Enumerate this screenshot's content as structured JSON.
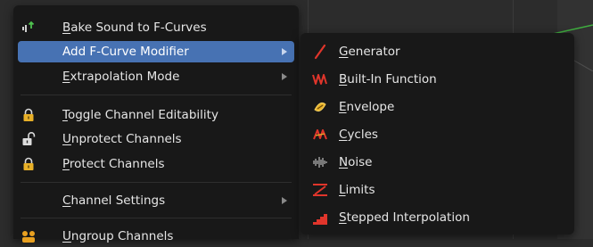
{
  "main_menu": {
    "items": [
      {
        "label": "Bake Sound to F-Curves",
        "icon": "speaker-bake-icon"
      },
      {
        "label": "Add F-Curve Modifier",
        "icon": null,
        "submenu": true,
        "active": true
      },
      {
        "label": "Extrapolation Mode",
        "icon": null,
        "submenu": true
      },
      {
        "label": "Toggle Channel Editability",
        "icon": "lock-icon"
      },
      {
        "label": "Unprotect Channels",
        "icon": "unlocked-icon"
      },
      {
        "label": "Protect Channels",
        "icon": "lock-icon"
      },
      {
        "label": "Channel Settings",
        "icon": null,
        "submenu": true
      },
      {
        "label": "Ungroup Channels",
        "icon": "group-icon"
      }
    ]
  },
  "sub_menu": {
    "items": [
      {
        "label": "Generator",
        "icon": "generator-icon"
      },
      {
        "label": "Built-In Function",
        "icon": "built-in-function-icon"
      },
      {
        "label": "Envelope",
        "icon": "envelope-icon"
      },
      {
        "label": "Cycles",
        "icon": "cycles-icon"
      },
      {
        "label": "Noise",
        "icon": "noise-icon"
      },
      {
        "label": "Limits",
        "icon": "limits-icon"
      },
      {
        "label": "Stepped Interpolation",
        "icon": "stepped-interpolation-icon"
      }
    ]
  },
  "colors": {
    "menu_bg": "#181818",
    "highlight": "#4772b3",
    "modifier_icon_red": "#e0352b",
    "lock_gold": "#e8b028"
  }
}
